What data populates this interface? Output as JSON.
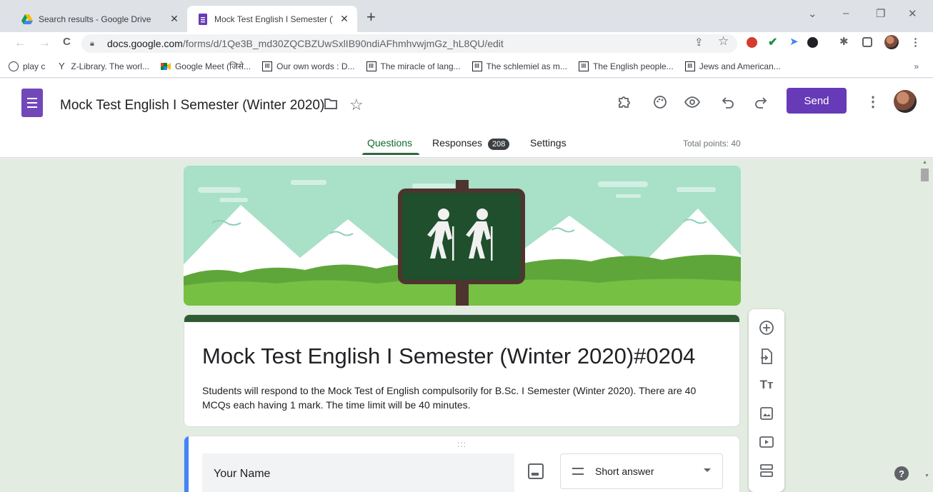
{
  "browser": {
    "tabs": [
      {
        "title": "Search results - Google Drive",
        "close": "✕",
        "icon": "google-drive-icon"
      },
      {
        "title": "Mock Test English I Semester (Wi",
        "close": "✕",
        "icon": "google-forms-icon"
      }
    ],
    "new_tab": "+",
    "window_controls": {
      "dropdown": "⌄",
      "minimize": "–",
      "restore": "❐",
      "close": "✕"
    },
    "nav": {
      "back": "←",
      "forward": "→",
      "reload": "C"
    },
    "url_host": "docs.google.com",
    "url_path": "/forms/d/1Qe3B_md30ZQCBZUwSxlIB90ndiAFhmhvwjmGz_hL8QU/edit",
    "omnibox_icons": {
      "share": "⇪",
      "star": "☆"
    },
    "bookmarks": [
      {
        "label": "play c",
        "icon": "globe-icon"
      },
      {
        "label": "Z-Library. The worl...",
        "icon": "zlibrary-icon"
      },
      {
        "label": "Google Meet (जिसे...",
        "icon": "google-meet-icon"
      },
      {
        "label": "Our own words : D...",
        "icon": "library-icon"
      },
      {
        "label": "The miracle of lang...",
        "icon": "library-icon"
      },
      {
        "label": "The schlemiel as m...",
        "icon": "library-icon"
      },
      {
        "label": "The English people...",
        "icon": "library-icon"
      },
      {
        "label": "Jews and American...",
        "icon": "library-icon"
      }
    ],
    "bookmarks_more": "»"
  },
  "form_header": {
    "doc_title": "Mock Test English I Semester (Winter 2020)",
    "send_label": "Send",
    "tabs": {
      "questions": "Questions",
      "responses": "Responses",
      "settings": "Settings"
    },
    "responses_count": "208",
    "total_points": "Total points: 40"
  },
  "form": {
    "title": "Mock Test English I Semester (Winter 2020)#0204",
    "description": "Students will respond to the Mock Test of English compulsorily for B.Sc. I Semester (Winter 2020). There are 40 MCQs each having 1 mark. The time limit will be 40 minutes.",
    "question": {
      "title": "Your Name",
      "type": "Short answer",
      "drag_handle": ":::"
    }
  },
  "side_toolbar": [
    "add-question-icon",
    "import-questions-icon",
    "add-title-icon",
    "add-image-icon",
    "add-video-icon",
    "add-section-icon"
  ],
  "help": "?",
  "colors": {
    "accent": "#673ab7",
    "theme": "#2e5b33",
    "page_bg": "#e3ece0",
    "question_bar": "#4285f4"
  }
}
